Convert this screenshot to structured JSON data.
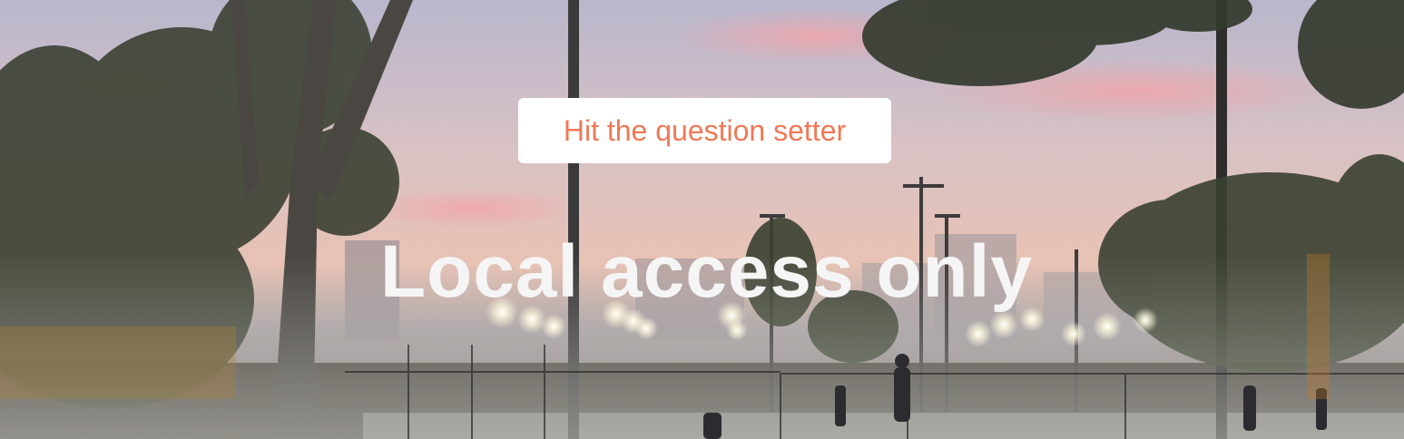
{
  "hero": {
    "background_description_icon": "park-sunset-photo",
    "button_label": "Hit the question setter",
    "headline": "Local access only",
    "colors": {
      "button_text": "#f07856",
      "button_bg": "#ffffff",
      "headline": "#f5f5f5"
    }
  }
}
